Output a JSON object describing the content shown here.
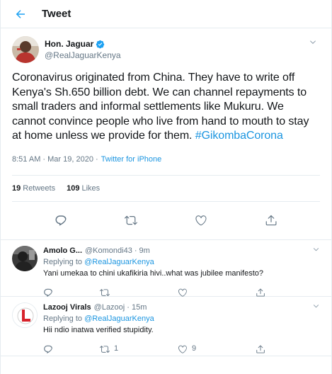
{
  "header": {
    "title": "Tweet"
  },
  "tweet": {
    "name": "Hon. Jaguar",
    "handle": "@RealJaguarKenya",
    "text": "Coronavirus originated from China. They have to write off Kenya's Sh.650 billion debt. We can channel repayments to small traders and informal settlements like Mukuru. We cannot convince people who live from hand to mouth to stay at home unless we provide for them.",
    "hashtag": "#GikombaCorona",
    "time": "8:51 AM · Mar 19, 2020 ·",
    "source": "Twitter for iPhone",
    "retweets": "19",
    "retweets_label": "Retweets",
    "likes": "109",
    "likes_label": "Likes"
  },
  "replies": [
    {
      "name": "Amolo G...",
      "handle": "@Komondi43",
      "time": "· 9m",
      "replying_prefix": "Replying to",
      "replying_to": "@RealJaguarKenya",
      "text": "Yani umekaa to chini ukafikiria hivi..what was jubilee manifesto?",
      "retweets": "",
      "likes": ""
    },
    {
      "name": "Lazooj Virals",
      "handle": "@Lazooj",
      "time": "· 15m",
      "replying_prefix": "Replying to",
      "replying_to": "@RealJaguarKenya",
      "text": "Hii ndio inatwa verified stupidity.",
      "retweets": "1",
      "likes": "9"
    }
  ],
  "colors": {
    "accent": "#1da1f2",
    "link": "#1b95e0",
    "muted": "#657786"
  },
  "icons": [
    "back-arrow-icon",
    "verified-badge-icon",
    "chevron-down-icon",
    "reply-icon",
    "retweet-icon",
    "like-icon",
    "share-icon"
  ]
}
